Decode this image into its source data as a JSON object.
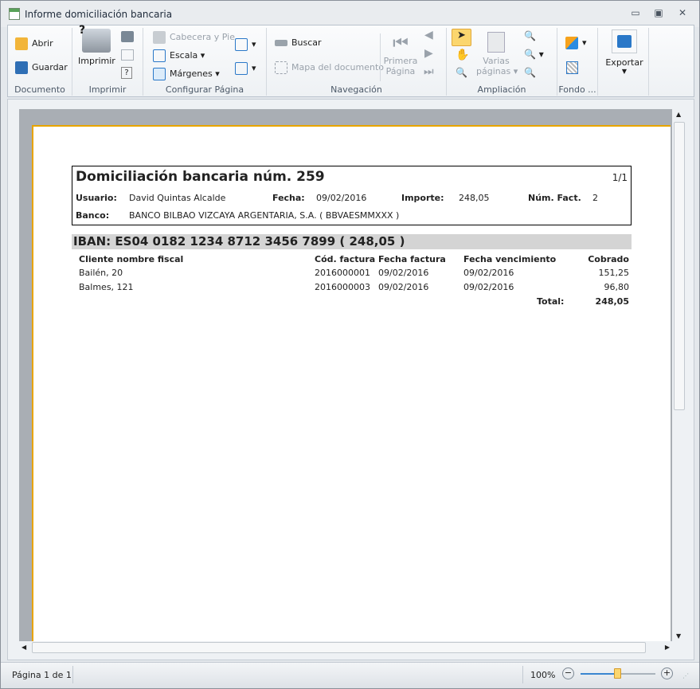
{
  "window": {
    "title": "Informe domiciliación bancaria",
    "minimize": "▭",
    "restore": "▣",
    "close": "✕"
  },
  "ribbon": {
    "groups": {
      "documento": "Documento",
      "imprimir": "Imprimir",
      "configurar": "Configurar Página",
      "navegacion": "Navegación",
      "ampliacion": "Ampliación",
      "fondo": "Fondo ...",
      "exportar": ""
    },
    "abrir": "Abrir",
    "guardar": "Guardar",
    "imprimir": "Imprimir",
    "cabecera": "Cabecera y Pie",
    "escala": "Escala",
    "margenes": "Márgenes",
    "buscar": "Buscar",
    "mapa": "Mapa del documento",
    "primera_line1": "Primera",
    "primera_line2": "Página",
    "varias_line1": "Varias",
    "varias_line2": "páginas",
    "exportar": "Exportar"
  },
  "report": {
    "title": "Domiciliación bancaria núm. 259",
    "page_of": "1/1",
    "usuario_label": "Usuario:",
    "usuario": "David Quintas Alcalde",
    "fecha_label": "Fecha:",
    "fecha": "09/02/2016",
    "importe_label": "Importe:",
    "importe": "248,05",
    "numfact_label": "Núm. Fact.",
    "numfact": "2",
    "banco_label": "Banco:",
    "banco": "BANCO BILBAO VIZCAYA ARGENTARIA, S.A. ( BBVAESMMXXX )",
    "iban": "IBAN: ES04 0182 1234 8712 3456 7899 ( 248,05 )",
    "columns": [
      "Cliente nombre fiscal",
      "Cód. factura",
      "Fecha factura",
      "Fecha vencimiento",
      "Cobrado"
    ],
    "rows": [
      [
        "Bailén, 20",
        "2016000001",
        "09/02/2016",
        "09/02/2016",
        "151,25"
      ],
      [
        "Balmes, 121",
        "2016000003",
        "09/02/2016",
        "09/02/2016",
        "96,80"
      ]
    ],
    "total_label": "Total:",
    "total": "248,05"
  },
  "status": {
    "page": "Página 1 de 1",
    "zoom": "100%",
    "zoom_slider_fraction": 0.49
  },
  "colors": {
    "accent": "#e8a400",
    "iban_bar": "#d4d4d4"
  }
}
